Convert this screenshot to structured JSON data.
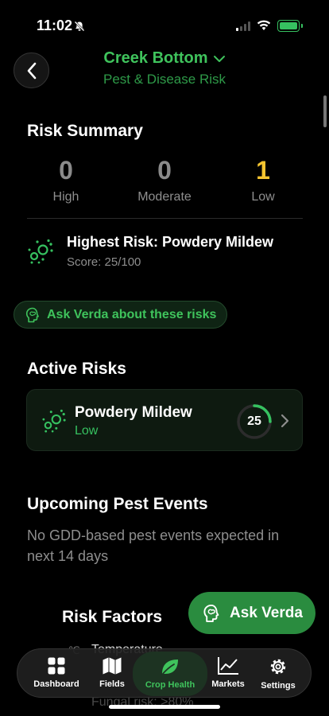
{
  "status_bar": {
    "time": "11:02"
  },
  "header": {
    "title": "Creek Bottom",
    "subtitle": "Pest & Disease Risk"
  },
  "risk_summary": {
    "heading": "Risk Summary",
    "counts": [
      {
        "value": "0",
        "label": "High"
      },
      {
        "value": "0",
        "label": "Moderate"
      },
      {
        "value": "1",
        "label": "Low"
      }
    ],
    "highest_title": "Highest Risk: Powdery Mildew",
    "highest_score": "Score: 25/100"
  },
  "ask_pill": {
    "label": "Ask Verda about these risks"
  },
  "active_risks": {
    "heading": "Active Risks",
    "items": [
      {
        "name": "Powdery Mildew",
        "level": "Low",
        "score": "25",
        "score_fraction": 0.25
      }
    ]
  },
  "pest_events": {
    "heading": "Upcoming Pest Events",
    "message": "No GDD-based pest events expected in next 14 days"
  },
  "risk_factors": {
    "heading": "Risk Factors",
    "first_factor_title": "Temperature",
    "first_factor_detail": "Fungal risk: >80%"
  },
  "fab": {
    "label": "Ask Verda"
  },
  "tabs": [
    {
      "label": "Dashboard",
      "icon": "grid-icon"
    },
    {
      "label": "Fields",
      "icon": "map-icon"
    },
    {
      "label": "Crop Health",
      "icon": "leaf-icon"
    },
    {
      "label": "Markets",
      "icon": "chart-icon"
    },
    {
      "label": "Settings",
      "icon": "gear-icon"
    }
  ],
  "colors": {
    "accent": "#3fc35c",
    "low": "#f4c430",
    "fab": "#2a8c3f",
    "card": "#0e1a10"
  }
}
